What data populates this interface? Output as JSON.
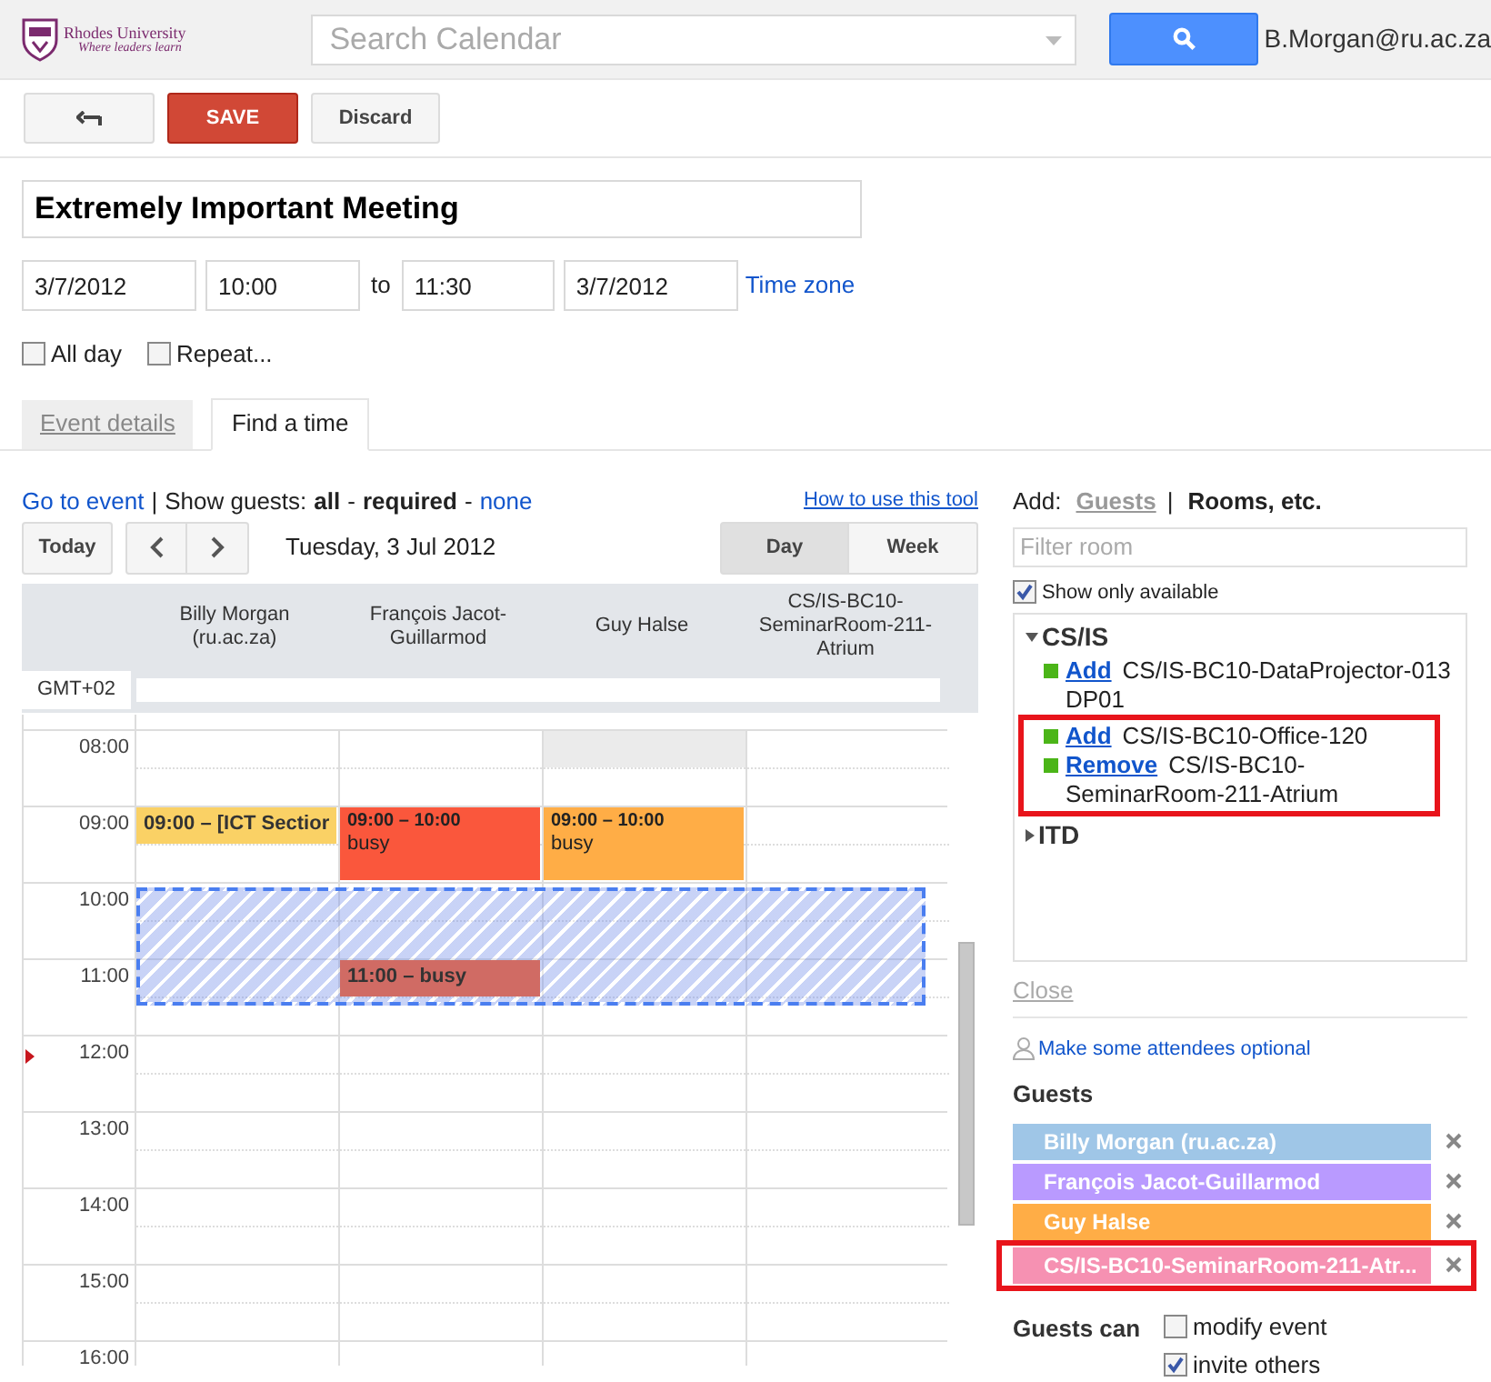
{
  "header": {
    "logo": {
      "name": "Rhodes University",
      "tagline": "Where leaders learn"
    },
    "search": {
      "placeholder": "Search Calendar"
    },
    "account": "B.Morgan@ru.ac.za"
  },
  "toolbar": {
    "buttons": [
      {
        "kind": "back"
      },
      {
        "kind": "primary",
        "label": "SAVE"
      },
      {
        "kind": "plain",
        "label": "Discard"
      }
    ]
  },
  "event": {
    "title": "Extremely Important Meeting",
    "start_date": "3/7/2012",
    "start_time": "10:00",
    "to": "to",
    "end_time": "11:30",
    "end_date": "3/7/2012",
    "timezone_link": "Time zone",
    "options": [
      {
        "label": "All day",
        "checked": false
      },
      {
        "label": "Repeat...",
        "checked": false
      }
    ]
  },
  "tabs": [
    {
      "label": "Event details",
      "selected": false
    },
    {
      "label": "Find a time",
      "selected": true
    }
  ],
  "finder": {
    "go_to_event": "Go to event",
    "separator": "|",
    "show_guests_label": "Show guests:",
    "dash": "-",
    "filters": [
      {
        "label": "all",
        "selected": true
      },
      {
        "label": "required",
        "selected": true
      },
      {
        "label": "none",
        "selected": false
      }
    ],
    "help_link": "How to use this tool",
    "today": "Today",
    "date": "Tuesday, 3 Jul 2012",
    "views": [
      {
        "label": "Day",
        "selected": true
      },
      {
        "label": "Week",
        "selected": false
      }
    ],
    "timezone": "GMT+02",
    "columns": [
      {
        "name": "Billy Morgan (ru.ac.za)"
      },
      {
        "name": "François Jacot-Guillarmod"
      },
      {
        "name": "Guy Halse"
      },
      {
        "name": "CS/IS-BC10-SeminarRoom-211-Atrium"
      }
    ],
    "hours": [
      {
        "label": "08:00",
        "selected": false,
        "partial": false,
        "current": false,
        "cells": [
          null,
          null,
          {
            "kind": "blocked"
          },
          null
        ]
      },
      {
        "label": "09:00",
        "selected": false,
        "partial": false,
        "current": false,
        "cells": [
          {
            "kind": "half",
            "time": "09:00 – [ICT Sectior",
            "color": "#fad165"
          },
          {
            "kind": "full",
            "time": "09:00 – 10:00",
            "text": "busy",
            "color": "#fa573c"
          },
          {
            "kind": "full",
            "time": "09:00 – 10:00",
            "text": "busy",
            "color": "#ffad46"
          },
          null
        ]
      },
      {
        "label": "10:00",
        "selected": true,
        "partial": false,
        "current": false,
        "cells": [
          null,
          null,
          null,
          null
        ]
      },
      {
        "label": "11:00",
        "selected": true,
        "partial": true,
        "current": false,
        "cells": [
          null,
          {
            "kind": "half",
            "time": "11:00 – busy",
            "color": "#d06b64"
          },
          null,
          null
        ]
      },
      {
        "label": "12:00",
        "selected": false,
        "partial": false,
        "current": true,
        "cells": [
          null,
          null,
          null,
          null
        ]
      },
      {
        "label": "13:00",
        "selected": false,
        "partial": false,
        "current": false,
        "cells": [
          null,
          null,
          null,
          null
        ]
      },
      {
        "label": "14:00",
        "selected": false,
        "partial": false,
        "current": false,
        "cells": [
          null,
          null,
          null,
          null
        ]
      },
      {
        "label": "15:00",
        "selected": false,
        "partial": false,
        "current": false,
        "cells": [
          null,
          null,
          null,
          null
        ]
      },
      {
        "label": "16:00",
        "selected": false,
        "partial": false,
        "current": false,
        "cells": [
          null,
          null,
          null,
          null
        ]
      }
    ]
  },
  "rooms_panel": {
    "add_label": "Add:",
    "separator": "|",
    "sources": [
      {
        "label": "Guests",
        "selected": false
      },
      {
        "label": "Rooms, etc.",
        "selected": true
      }
    ],
    "filter": {
      "placeholder": "Filter room"
    },
    "only_available": {
      "label": "Show only available",
      "checked": true
    },
    "groups": [
      {
        "name": "CS/IS",
        "expanded": true,
        "items": [
          {
            "action": "Add",
            "name": "CS/IS-BC10-DataProjector-013 DP01",
            "highlighted": false
          },
          {
            "action": "Add",
            "name": "CS/IS-BC10-Office-120",
            "highlighted": true
          },
          {
            "action": "Remove",
            "name": "CS/IS-BC10-SeminarRoom-211-Atrium",
            "highlighted": true
          }
        ]
      },
      {
        "name": "ITD",
        "expanded": false
      }
    ],
    "close": "Close"
  },
  "guests": {
    "optional_link": "Make some attendees optional",
    "heading": "Guests",
    "list": [
      {
        "name": "Billy Morgan (ru.ac.za)",
        "color": "#9fc6e7",
        "highlighted": false
      },
      {
        "name": "François Jacot-Guillarmod",
        "color": "#b99aff",
        "highlighted": false
      },
      {
        "name": "Guy Halse",
        "color": "#ffad46",
        "highlighted": false
      },
      {
        "name": "CS/IS-BC10-SeminarRoom-211-Atr...",
        "color": "#f691b2",
        "highlighted": true
      }
    ],
    "permissions_label": "Guests can",
    "permissions": [
      {
        "label": "modify event",
        "checked": false
      },
      {
        "label": "invite others",
        "checked": true
      }
    ]
  }
}
